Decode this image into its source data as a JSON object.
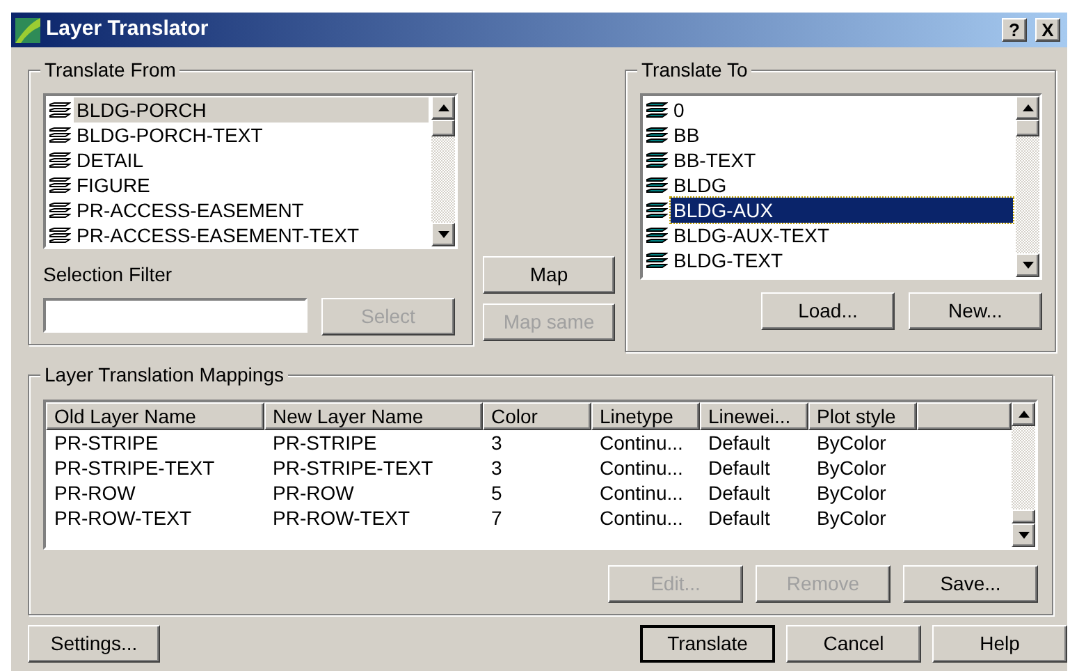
{
  "window": {
    "title": "Layer Translator",
    "help_button": "?",
    "close_button": "X"
  },
  "translate_from": {
    "title": "Translate From",
    "items": [
      {
        "label": "BLDG-PORCH",
        "selected": true
      },
      {
        "label": "BLDG-PORCH-TEXT",
        "selected": false
      },
      {
        "label": "DETAIL",
        "selected": false
      },
      {
        "label": "FIGURE",
        "selected": false
      },
      {
        "label": "PR-ACCESS-EASEMENT",
        "selected": false
      },
      {
        "label": "PR-ACCESS-EASEMENT-TEXT",
        "selected": false
      }
    ],
    "filter_label": "Selection Filter",
    "select_button": {
      "label": "Select",
      "disabled": true
    }
  },
  "middle_buttons": [
    {
      "label": "Map",
      "disabled": false
    },
    {
      "label": "Map same",
      "disabled": true
    }
  ],
  "translate_to": {
    "title": "Translate To",
    "items": [
      {
        "label": "0",
        "selected": false
      },
      {
        "label": "BB",
        "selected": false
      },
      {
        "label": "BB-TEXT",
        "selected": false
      },
      {
        "label": "BLDG",
        "selected": false
      },
      {
        "label": "BLDG-AUX",
        "selected": true
      },
      {
        "label": "BLDG-AUX-TEXT",
        "selected": false
      },
      {
        "label": "BLDG-TEXT",
        "selected": false
      }
    ],
    "buttons": [
      {
        "label": "Load...",
        "disabled": false
      },
      {
        "label": "New...",
        "disabled": false
      }
    ]
  },
  "mappings": {
    "title": "Layer Translation Mappings",
    "columns": [
      "Old Layer Name",
      "New Layer Name",
      "Color",
      "Linetype",
      "Linewei...",
      "Plot style"
    ],
    "rows": [
      [
        "PR-STRIPE",
        "PR-STRIPE",
        "3",
        "Continu...",
        "Default",
        "ByColor"
      ],
      [
        "PR-STRIPE-TEXT",
        "PR-STRIPE-TEXT",
        "3",
        "Continu...",
        "Default",
        "ByColor"
      ],
      [
        "PR-ROW",
        "PR-ROW",
        "5",
        "Continu...",
        "Default",
        "ByColor"
      ],
      [
        "PR-ROW-TEXT",
        "PR-ROW-TEXT",
        "7",
        "Continu...",
        "Default",
        "ByColor"
      ]
    ],
    "buttons": [
      {
        "label": "Edit...",
        "disabled": true
      },
      {
        "label": "Remove",
        "disabled": true
      },
      {
        "label": "Save...",
        "disabled": false
      }
    ]
  },
  "footer": {
    "left": [
      {
        "label": "Settings...",
        "default": false
      }
    ],
    "right": [
      {
        "label": "Translate",
        "default": true
      },
      {
        "label": "Cancel",
        "default": false
      },
      {
        "label": "Help",
        "default": false
      }
    ]
  }
}
